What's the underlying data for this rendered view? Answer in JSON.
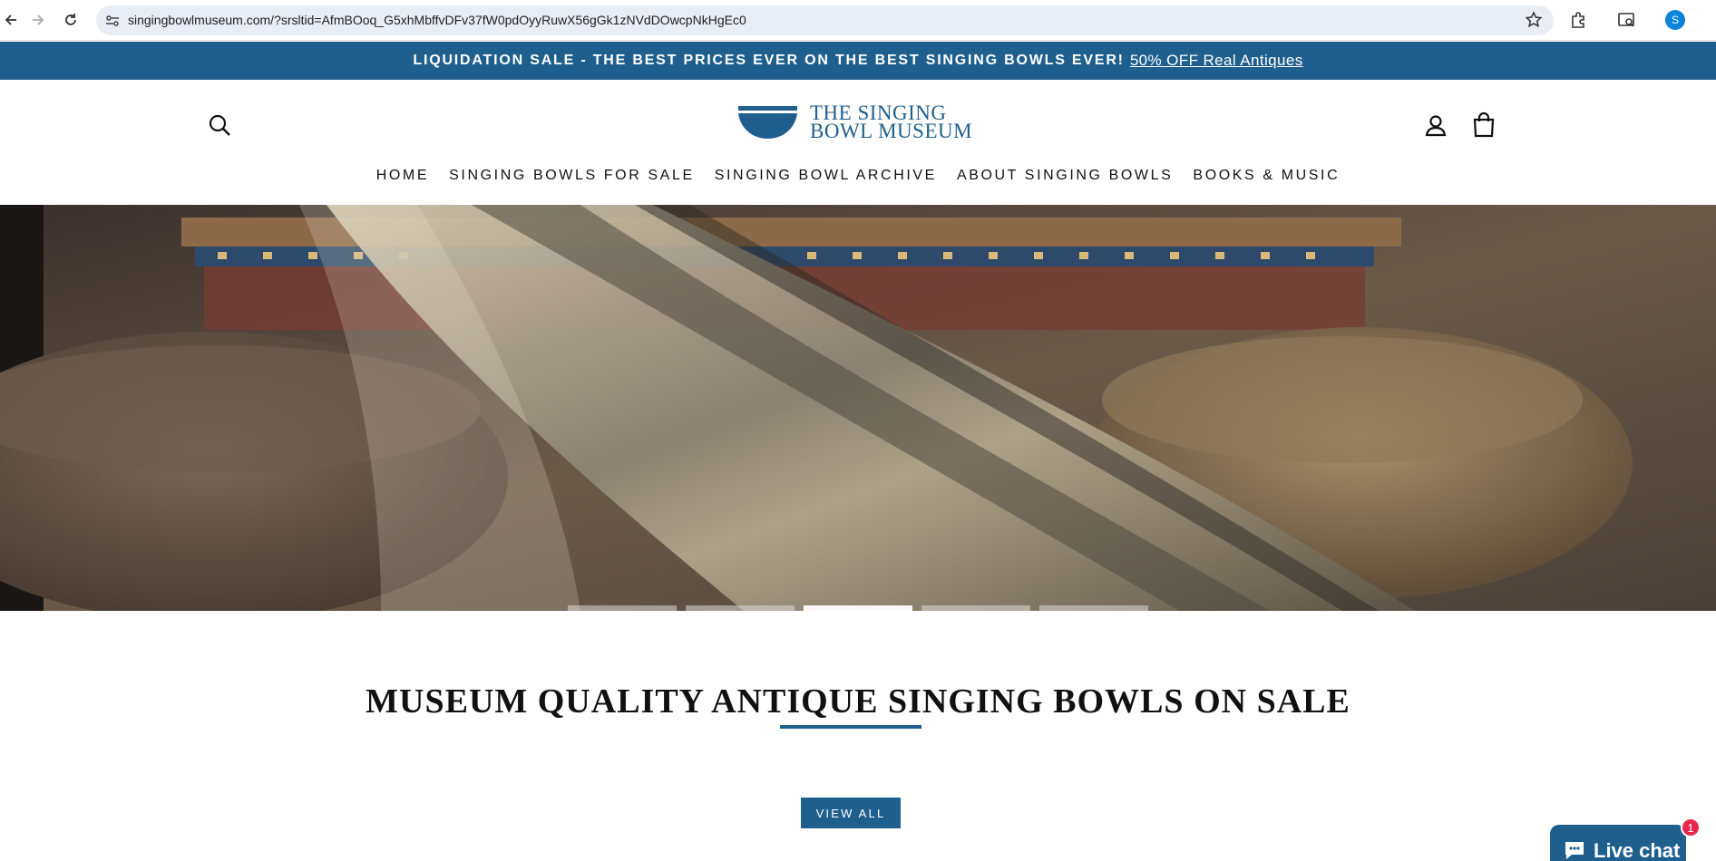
{
  "browser": {
    "url": "singingbowlmuseum.com/?srsltid=AfmBOoq_G5xhMbffvDFv37fW0pdOyyRuwX56gGk1zNVdDOwcpNkHgEc0",
    "profile_initial": "S"
  },
  "announcement": {
    "text": "LIQUIDATION SALE - THE BEST PRICES EVER ON THE BEST SINGING BOWLS EVER!",
    "link": "50% OFF Real Antiques"
  },
  "header": {
    "logo_line1": "THE SINGING",
    "logo_line2": "BOWL MUSEUM",
    "menu": [
      {
        "label": "HOME"
      },
      {
        "label": "SINGING BOWLS FOR SALE"
      },
      {
        "label": "SINGING BOWL ARCHIVE"
      },
      {
        "label": "ABOUT SINGING BOWLS"
      },
      {
        "label": "BOOKS & MUSIC"
      }
    ]
  },
  "hero": {
    "slides_total": 5,
    "active_slide": 3
  },
  "section": {
    "title": "MUSEUM QUALITY ANTIQUE SINGING BOWLS ON SALE",
    "button": "VIEW ALL"
  },
  "chat": {
    "label": "Live chat",
    "badge_count": "1"
  },
  "colors": {
    "brand": "#1f5f8e",
    "badge": "#e5294d"
  }
}
